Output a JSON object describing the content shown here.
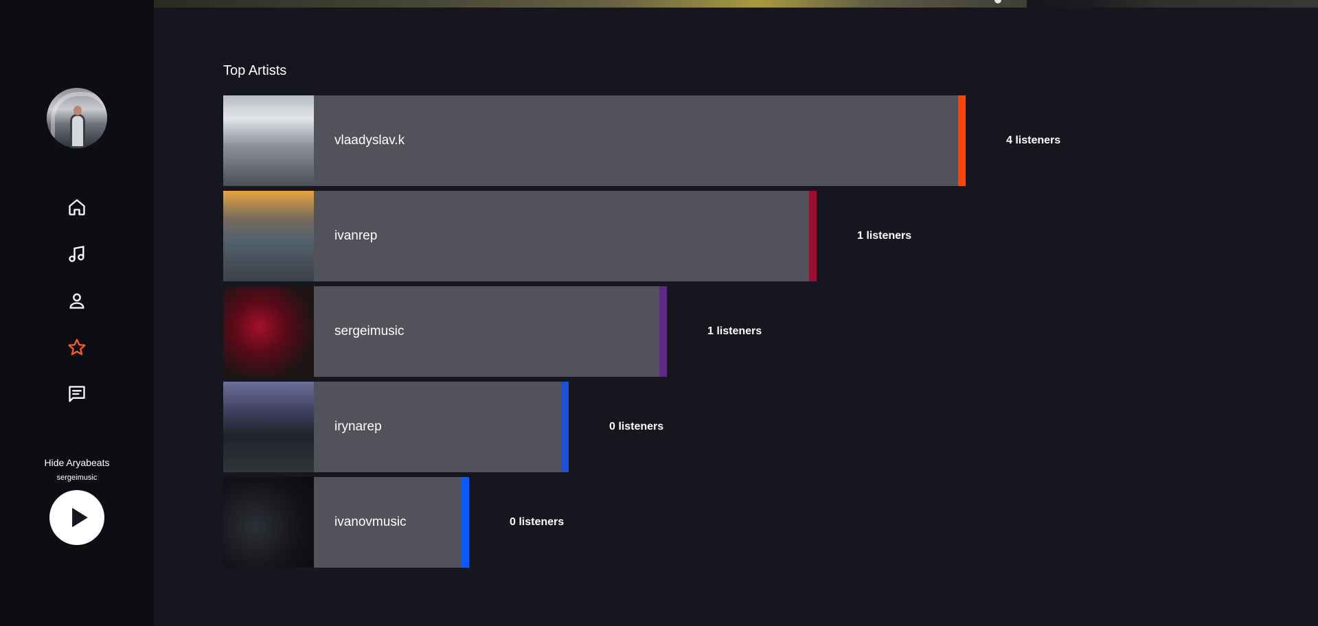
{
  "sidebar": {
    "nav": [
      {
        "icon": "home-icon"
      },
      {
        "icon": "music-note-icon"
      },
      {
        "icon": "user-icon"
      },
      {
        "icon": "star-icon",
        "active": true
      },
      {
        "icon": "message-icon"
      }
    ],
    "now_playing": {
      "title": "Hide Aryabeats",
      "artist": "sergeimusic"
    },
    "accent_color": "#ff5a1f"
  },
  "main": {
    "section_title": "Top Artists",
    "artists": [
      {
        "name": "vlaadyslav.k",
        "listeners_label": "4 listeners",
        "bar_fraction": 1.0,
        "accent": "#ff4500"
      },
      {
        "name": "ivanrep",
        "listeners_label": "1 listeners",
        "bar_fraction": 0.799,
        "accent": "#9b1030"
      },
      {
        "name": "sergeimusic",
        "listeners_label": "1 listeners",
        "bar_fraction": 0.598,
        "accent": "#5b2a86"
      },
      {
        "name": "irynarep",
        "listeners_label": "0 listeners",
        "bar_fraction": 0.465,
        "accent": "#1a4fd6"
      },
      {
        "name": "ivanovmusic",
        "listeners_label": "0 listeners",
        "bar_fraction": 0.331,
        "accent": "#0a5cff"
      }
    ]
  }
}
